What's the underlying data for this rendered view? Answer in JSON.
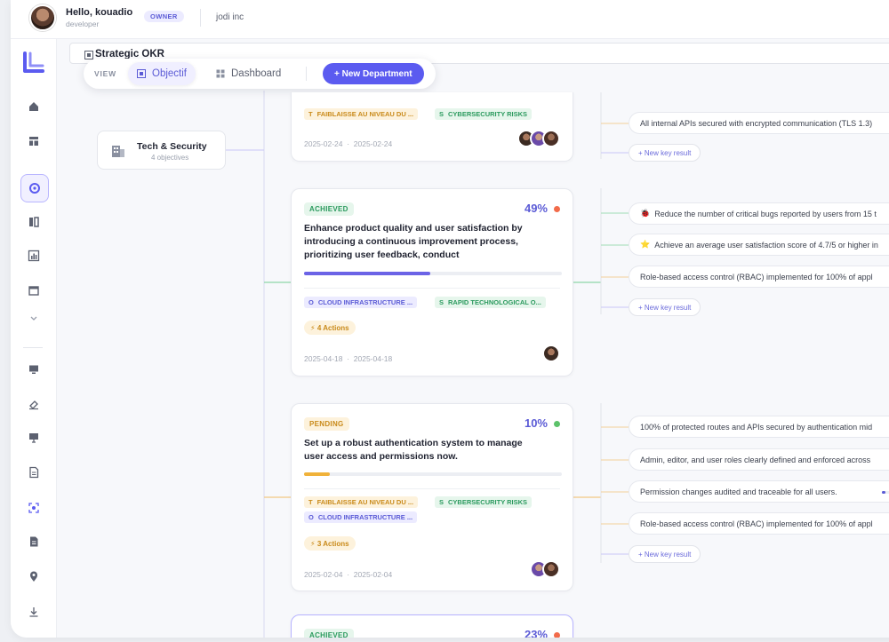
{
  "header": {
    "greeting": "Hello, kouadio",
    "role": "developer",
    "badge": "OWNER",
    "company": "jodi inc"
  },
  "breadcrumb": {
    "title": "Strategic OKR"
  },
  "view_bar": {
    "label": "VIEW",
    "tabs": [
      {
        "label": "Objectif",
        "active": true
      },
      {
        "label": "Dashboard",
        "active": false
      }
    ],
    "new_department_label": "+ New Department"
  },
  "department": {
    "name": "Tech & Security",
    "subtitle": "4 objectives"
  },
  "objectives": [
    {
      "tags": [
        {
          "prefix": "T",
          "label": "FAIBLAISSE AU NIVEAU DU ..."
        },
        {
          "prefix": "S",
          "label": "CYBERSECURITY RISKS"
        }
      ],
      "start_date": "2025-02-24",
      "end_date": "2025-02-24"
    },
    {
      "status": "ACHIEVED",
      "percent": "49%",
      "progress": 0.49,
      "dot_color": "#f26b4a",
      "title": "Enhance product quality and user satisfaction by introducing a continuous improvement process, prioritizing user feedback, conduct",
      "tags": [
        {
          "prefix": "O",
          "label": "CLOUD INFRASTRUCTURE ..."
        },
        {
          "prefix": "S",
          "label": "RAPID TECHNOLOGICAL O..."
        }
      ],
      "actions": "⚡ 4 Actions",
      "start_date": "2025-04-18",
      "end_date": "2025-04-18"
    },
    {
      "status": "PENDING",
      "percent": "10%",
      "progress": 0.1,
      "dot_color": "#5cc26a",
      "title": "Set up a robust authentication system to manage user access and permissions now.",
      "tags": [
        {
          "prefix": "T",
          "label": "FAIBLAISSE AU NIVEAU DU ..."
        },
        {
          "prefix": "S",
          "label": "CYBERSECURITY RISKS"
        },
        {
          "prefix": "O",
          "label": "CLOUD INFRASTRUCTURE ..."
        }
      ],
      "actions": "⚡ 3 Actions",
      "start_date": "2025-02-04",
      "end_date": "2025-02-04"
    },
    {
      "status": "ACHIEVED",
      "percent": "23%",
      "dot_color": "#f26b4a"
    }
  ],
  "key_results": {
    "group1": [
      "All internal APIs secured with encrypted communication (TLS 1.3)"
    ],
    "group2": [
      {
        "icon": "🐞",
        "text": "Reduce the number of critical bugs reported by users from 15 t"
      },
      {
        "icon": "⭐",
        "text": "Achieve an average user satisfaction score of 4.7/5 or higher in"
      },
      {
        "icon": "",
        "text": "Role-based access control (RBAC) implemented for 100% of appl"
      }
    ],
    "group3": [
      "100% of protected routes and APIs secured by authentication mid",
      "Admin, editor, and user roles clearly defined and enforced across",
      "Permission changes audited and traceable for all users.",
      "Role-based access control (RBAC) implemented for 100% of appl"
    ],
    "new_label": "+ New key result"
  },
  "colors": {
    "accent": "#5b5bf0",
    "achieved": "#2b9a5e",
    "pending": "#c98a1a",
    "connector_purple": "#c8c6f7",
    "connector_green": "#9fdcb6",
    "connector_orange": "#f3cf98"
  }
}
